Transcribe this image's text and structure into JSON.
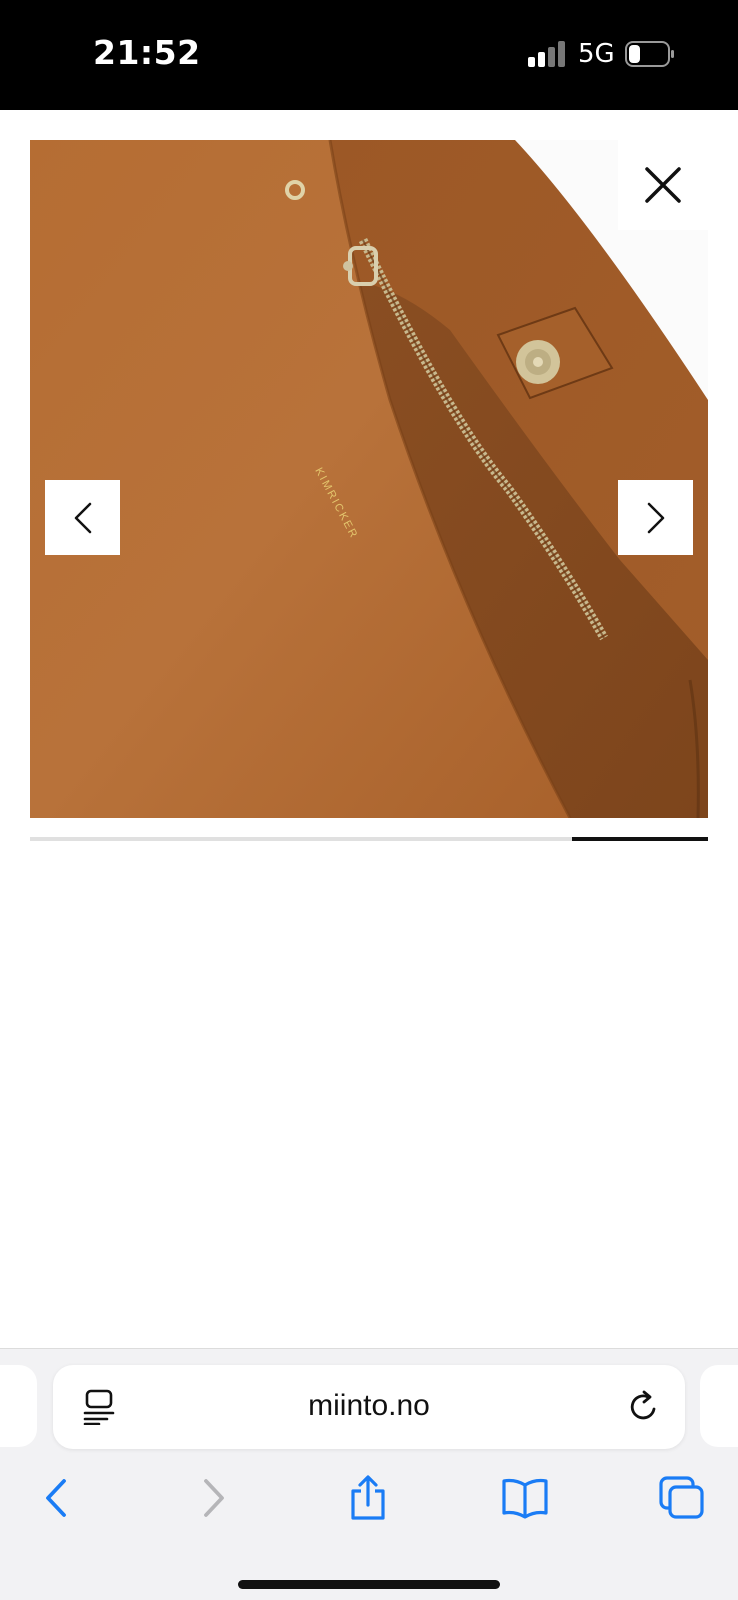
{
  "status_bar": {
    "time": "21:52",
    "network": "5G",
    "signal_icon": "cellular-signal-icon",
    "battery_icon": "battery-low-icon"
  },
  "gallery": {
    "product_image": "brown leather bag interior with zipper and magnetic snap",
    "brand_stamp": "KIMRICKER",
    "close_icon": "close-icon",
    "prev_icon": "chevron-left-icon",
    "next_icon": "chevron-right-icon",
    "progress": {
      "start_fraction": 0.8,
      "end_fraction": 1.0
    }
  },
  "browser": {
    "url": "miinto.no",
    "page_menu_icon": "page-menu-icon",
    "reload_icon": "reload-icon",
    "toolbar": [
      {
        "name": "back-button",
        "icon": "chevron-left-icon",
        "enabled": true
      },
      {
        "name": "forward-button",
        "icon": "chevron-right-icon",
        "enabled": false
      },
      {
        "name": "share-button",
        "icon": "share-icon",
        "enabled": true
      },
      {
        "name": "bookmarks-button",
        "icon": "book-icon",
        "enabled": true
      },
      {
        "name": "tabs-button",
        "icon": "tabs-icon",
        "enabled": true
      }
    ]
  },
  "colors": {
    "leather": "#b0682f",
    "leather_dark": "#8c4f21",
    "ios_blue": "#1a7cf5",
    "disabled_gray": "#b5b5b8"
  }
}
